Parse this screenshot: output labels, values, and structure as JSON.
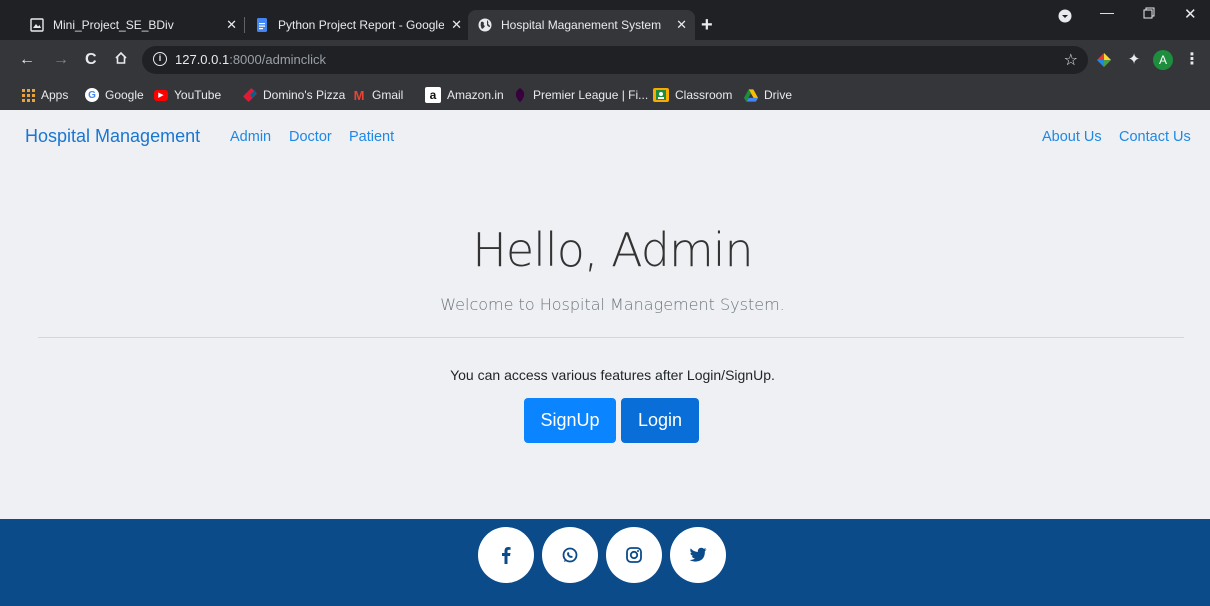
{
  "browser": {
    "tabs": [
      {
        "title": "Mini_Project_SE_BDiv",
        "active": false
      },
      {
        "title": "Python Project Report - Google D",
        "active": false
      },
      {
        "title": "Hospital Maganement System",
        "active": true
      }
    ],
    "address": {
      "host": "127.0.0.1",
      "path": ":8000/adminclick"
    },
    "avatar_letter": "A",
    "bookmarks": [
      "Apps",
      "Google",
      "YouTube",
      "Domino's Pizza",
      "Gmail",
      "Amazon.in",
      "Premier League | Fi...",
      "Classroom",
      "Drive"
    ]
  },
  "navbar": {
    "brand": "Hospital Management",
    "links": [
      "Admin",
      "Doctor",
      "Patient"
    ],
    "right_links": [
      "About Us",
      "Contact Us"
    ]
  },
  "hero": {
    "heading": "Hello, Admin",
    "subheading": "Welcome to Hospital Management System.",
    "note": "You can access various features after Login/SignUp.",
    "signup_label": "SignUp",
    "login_label": "Login"
  },
  "footer": {
    "social_icons": [
      "facebook-icon",
      "whatsapp-icon",
      "instagram-icon",
      "twitter-icon"
    ]
  },
  "colors": {
    "brand": "#1976d2",
    "signup_button": "#0a84ff",
    "login_button": "#0a6ed8",
    "footer": "#0c4b8a"
  }
}
